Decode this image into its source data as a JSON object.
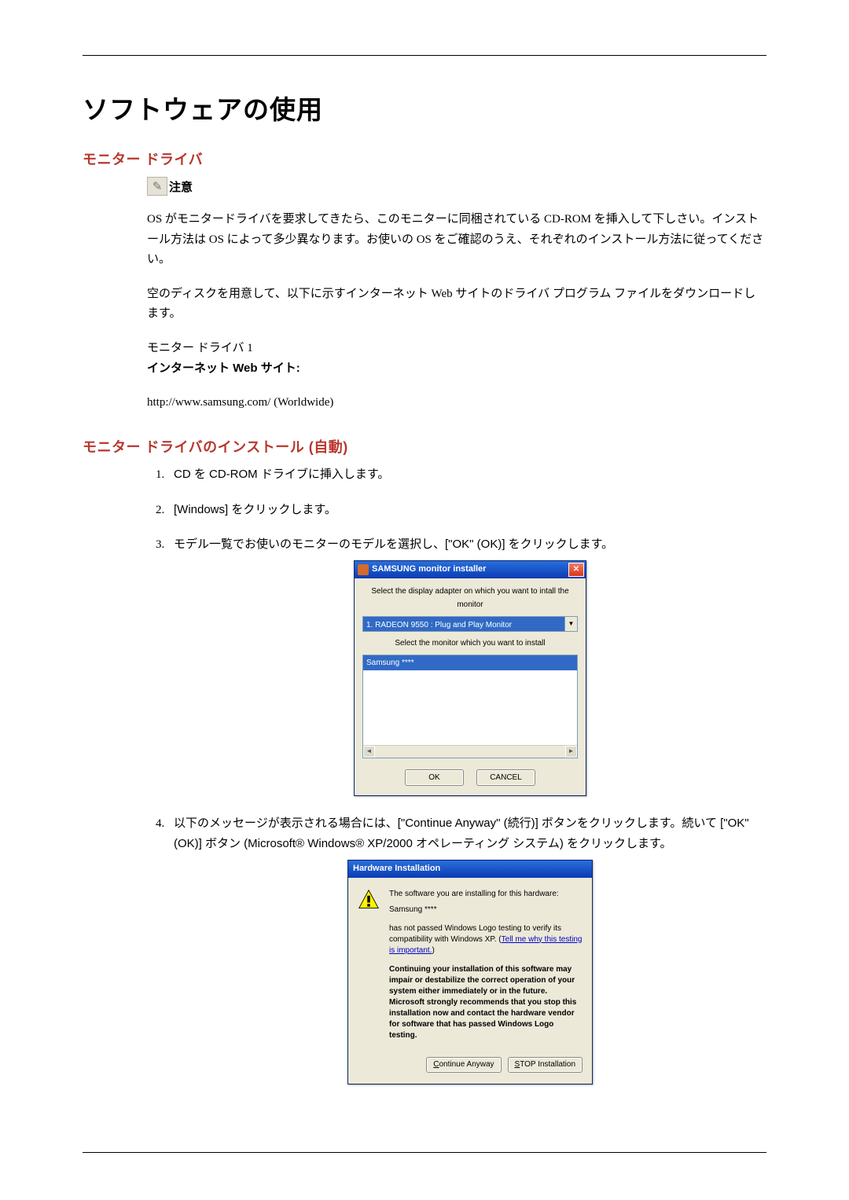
{
  "title": "ソフトウェアの使用",
  "section1": "モニター ドライバ",
  "note_label": "注意",
  "p1": "OS がモニタードライバを要求してきたら、このモニターに同梱されている CD-ROM を挿入して下しさい。インストール方法は OS によって多少異なります。お使いの OS をご確認のうえ、それぞれのインストール方法に従ってください。",
  "p2": "空のディスクを用意して、以下に示すインターネット Web サイトのドライバ プログラム ファイルをダウンロードします。",
  "label_line": "モニター ドライバ 1",
  "bold_line": "インターネット Web サイト:",
  "url_line": "http://www.samsung.com/ (Worldwide)",
  "section2": "モニター ドライバのインストール (自動)",
  "steps": [
    "CD を CD-ROM ドライブに挿入します。",
    "[Windows] をクリックします。",
    "モデル一覧でお使いのモニターのモデルを選択し、[\"OK\" (OK)] をクリックします。",
    "以下のメッセージが表示される場合には、[\"Continue Anyway\" (続行)] ボタンをクリックします。続いて [\"OK\" (OK)] ボタン (Microsoft® Windows® XP/2000 オペレーティング システム) をクリックします。"
  ],
  "installer": {
    "title": "SAMSUNG monitor installer",
    "label1": "Select the display adapter on which you want to intall the monitor",
    "combo": "1. RADEON 9550 : Plug and Play Monitor",
    "label2": "Select the monitor which you want to install",
    "list_item": "Samsung ****",
    "ok": "OK",
    "cancel": "CANCEL"
  },
  "hw": {
    "title": "Hardware Installation",
    "msg1": "The software you are installing for this hardware:",
    "device": "Samsung ****",
    "msg2a": "has not passed Windows Logo testing to verify its compatibility with Windows XP. (",
    "link": "Tell me why this testing is important.",
    "msg2b": ")",
    "msg_bold": "Continuing your installation of this software may impair or destabilize the correct operation of your system either immediately or in the future. Microsoft strongly recommends that you stop this installation now and contact the hardware vendor for software that has passed Windows Logo testing.",
    "btn_continue_u": "C",
    "btn_continue_rest": "ontinue Anyway",
    "btn_stop_u": "S",
    "btn_stop_rest": "TOP Installation"
  }
}
